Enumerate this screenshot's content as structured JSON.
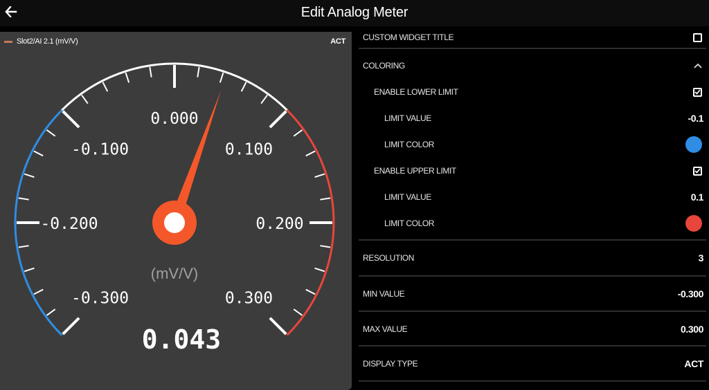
{
  "header": {
    "title": "Edit Analog Meter",
    "back_icon": "arrow-left-icon"
  },
  "widget": {
    "channel_label": "Slot2/AI 2.1 (mV/V)",
    "channel_color": "#c47a5a",
    "display_mode": "ACT",
    "gauge": {
      "min": -0.3,
      "max": 0.3,
      "value": 0.043,
      "value_text": "0.043",
      "unit": "(mV/V)",
      "tick_labels": [
        "-0.300",
        "-0.200",
        "-0.100",
        "0.000",
        "0.100",
        "0.200",
        "0.300"
      ],
      "tick_values": [
        -0.3,
        -0.2,
        -0.1,
        0.0,
        0.1,
        0.2,
        0.3
      ],
      "lower_limit": -0.1,
      "upper_limit": 0.1,
      "lower_color": "#2f8de4",
      "upper_color": "#e8463c",
      "needle_color": "#f4582a"
    }
  },
  "settings": {
    "custom_widget_title": {
      "label": "CUSTOM WIDGET TITLE",
      "checked": false
    },
    "coloring": {
      "label": "COLORING",
      "icon": "chevron-up-icon"
    },
    "enable_lower_limit": {
      "label": "ENABLE LOWER LIMIT",
      "checked": true
    },
    "lower_limit_value": {
      "label": "LIMIT VALUE",
      "value": "-0.1"
    },
    "lower_limit_color": {
      "label": "LIMIT COLOR",
      "color": "#2f8de4"
    },
    "enable_upper_limit": {
      "label": "ENABLE UPPER LIMIT",
      "checked": true
    },
    "upper_limit_value": {
      "label": "LIMIT VALUE",
      "value": "0.1"
    },
    "upper_limit_color": {
      "label": "LIMIT COLOR",
      "color": "#e8463c"
    },
    "resolution": {
      "label": "RESOLUTION",
      "value": "3"
    },
    "min_value": {
      "label": "MIN VALUE",
      "value": "-0.300"
    },
    "max_value": {
      "label": "MAX VALUE",
      "value": "0.300"
    },
    "display_type": {
      "label": "DISPLAY TYPE",
      "value": "ACT"
    }
  }
}
